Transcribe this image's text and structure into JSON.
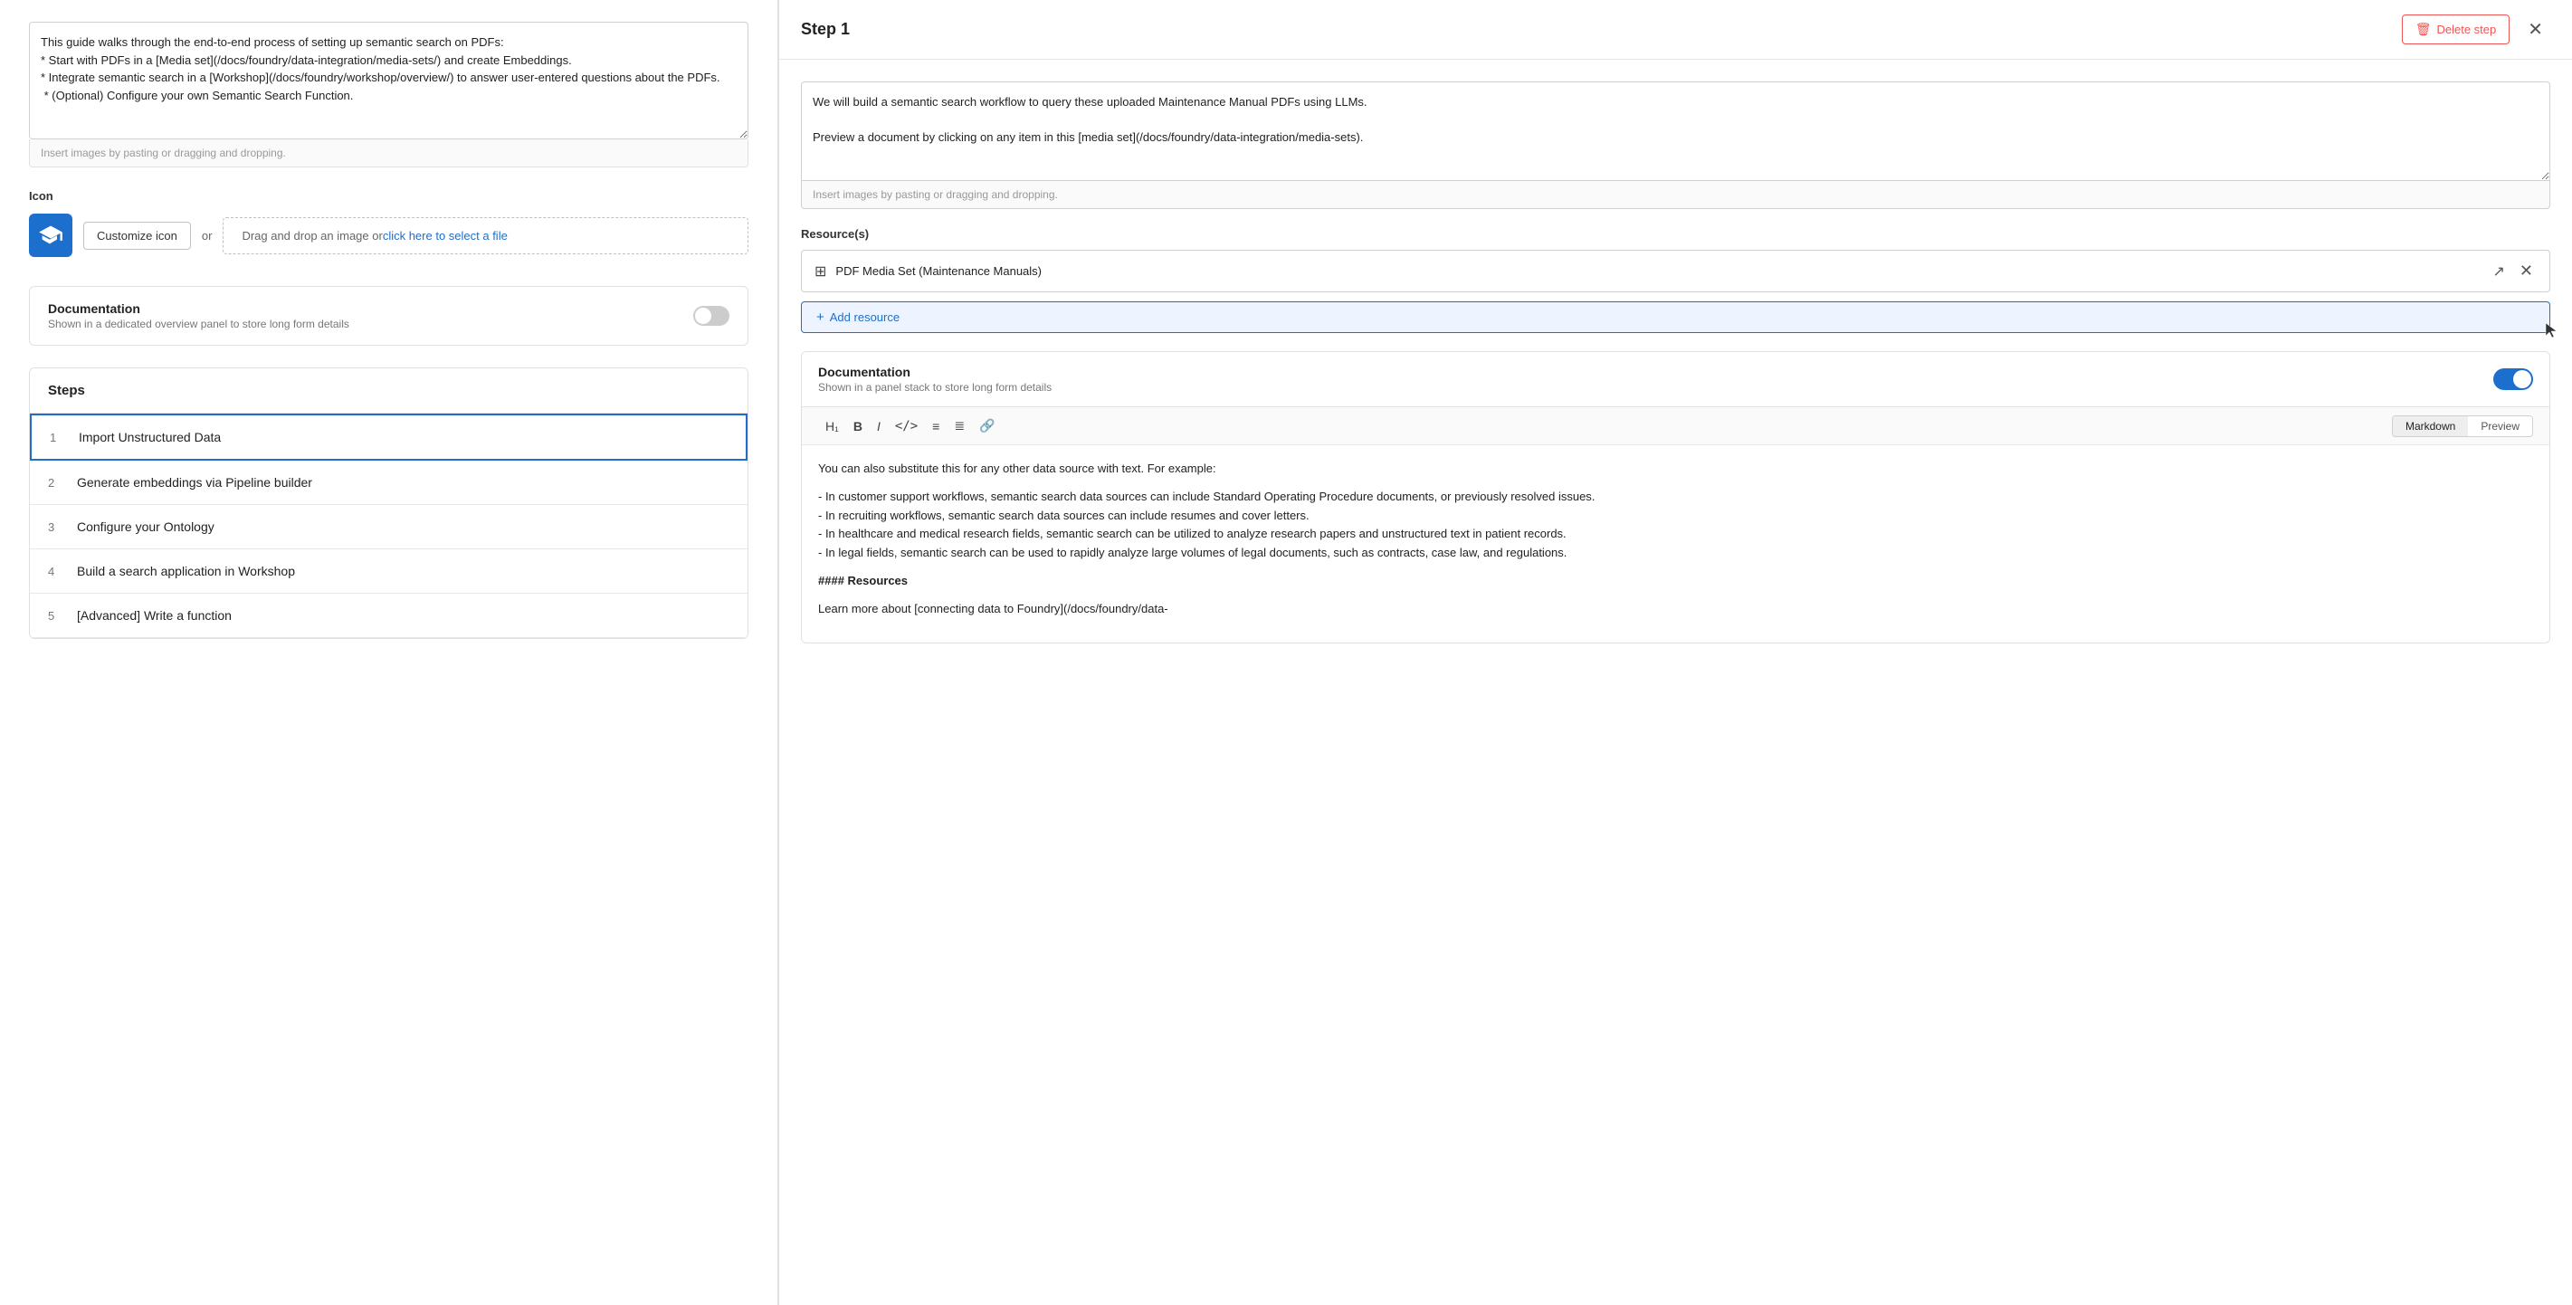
{
  "leftPanel": {
    "description": "This guide walks through the end-to-end process of setting up semantic search on PDFs:\n* Start with PDFs in a [Media set](/docs/foundry/data-integration/media-sets/) and create Embeddings.\n* Integrate semantic search in a [Workshop](/docs/foundry/workshop/overview/) to answer user-entered questions about the PDFs.\n * (Optional) Configure your own Semantic Search Function.",
    "imageDropHint": "Insert images by pasting or dragging and dropping.",
    "iconLabel": "Icon",
    "customizeIconLabel": "Customize icon",
    "orText": "or",
    "dragDropText": "Drag and drop an image or ",
    "dragDropLink": "click here to select a file",
    "documentationLabel": "Documentation",
    "documentationSubLabel": "Shown in a dedicated overview panel to store long form details",
    "stepsHeader": "Steps",
    "steps": [
      {
        "number": 1,
        "title": "Import Unstructured Data",
        "active": true
      },
      {
        "number": 2,
        "title": "Generate embeddings via Pipeline builder",
        "active": false
      },
      {
        "number": 3,
        "title": "Configure your Ontology",
        "active": false
      },
      {
        "number": 4,
        "title": "Build a search application in Workshop",
        "active": false
      },
      {
        "number": 5,
        "title": "[Advanced] Write a function",
        "active": false
      }
    ]
  },
  "rightPanel": {
    "stepTitle": "Step 1",
    "deleteStepLabel": "Delete step",
    "stepDescription": "We will build a semantic search workflow to query these uploaded Maintenance Manual PDFs using LLMs.\n\nPreview a document by clicking on any item in this [media set](/docs/foundry/data-integration/media-sets).",
    "imageDropHint": "Insert images by pasting or dragging and dropping.",
    "resourcesLabel": "Resource(s)",
    "resources": [
      {
        "id": 1,
        "name": "PDF Media Set (Maintenance Manuals)",
        "icon": "⊞"
      }
    ],
    "addResourceLabel": "Add resource",
    "documentation": {
      "title": "Documentation",
      "subtitle": "Shown in a panel stack to store long form details",
      "enabled": true,
      "toolbar": {
        "h1": "H₁",
        "bold": "B",
        "italic": "I",
        "code": "</>",
        "bulletList": "≡",
        "orderedList": "≣",
        "link": "🔗",
        "markdownTab": "Markdown",
        "previewTab": "Preview"
      },
      "content": "You can also substitute this for any other data source with text. For example:\n\n- In customer support workflows, semantic search data sources can include Standard Operating Procedure documents, or previously resolved issues.\n- In recruiting workflows, semantic search data sources can include resumes and cover letters.\n- In healthcare and medical research fields, semantic search can be utilized to analyze research papers and unstructured text in patient records.\n- In legal fields, semantic search can be used to rapidly analyze large volumes of legal documents, such as contracts, case law, and regulations.\n\n#### Resources\n\nLearn more about [connecting data to Foundry](/docs/foundry/data-"
    }
  }
}
